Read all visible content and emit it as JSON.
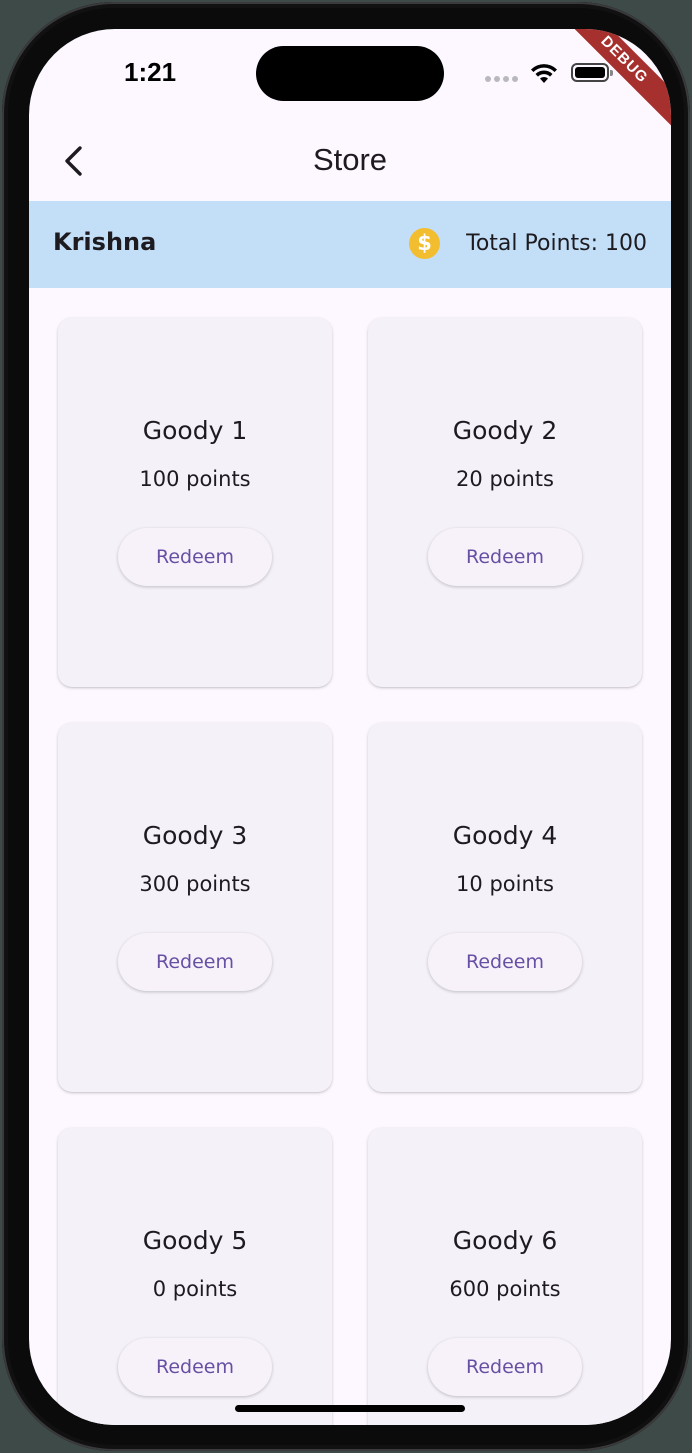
{
  "status_bar": {
    "time": "1:21"
  },
  "debug_banner": "DEBUG",
  "app_bar": {
    "title": "Store",
    "back_icon": "chevron-left-icon"
  },
  "user_banner": {
    "name": "Krishna",
    "points_label": "Total Points: 100",
    "coin_icon": "dollar-coin-icon",
    "coin_glyph": "$",
    "background": "#c3dff7",
    "coin_color": "#f2be30"
  },
  "goodies": [
    {
      "name": "Goody 1",
      "points": "100 points",
      "action": "Redeem"
    },
    {
      "name": "Goody 2",
      "points": "20 points",
      "action": "Redeem"
    },
    {
      "name": "Goody 3",
      "points": "300 points",
      "action": "Redeem"
    },
    {
      "name": "Goody 4",
      "points": "10 points",
      "action": "Redeem"
    },
    {
      "name": "Goody 5",
      "points": "0 points",
      "action": "Redeem"
    },
    {
      "name": "Goody 6",
      "points": "600 points",
      "action": "Redeem"
    }
  ],
  "colors": {
    "accent": "#6750a4",
    "card": "#f4f2f8",
    "surface": "#fdf7ff"
  }
}
